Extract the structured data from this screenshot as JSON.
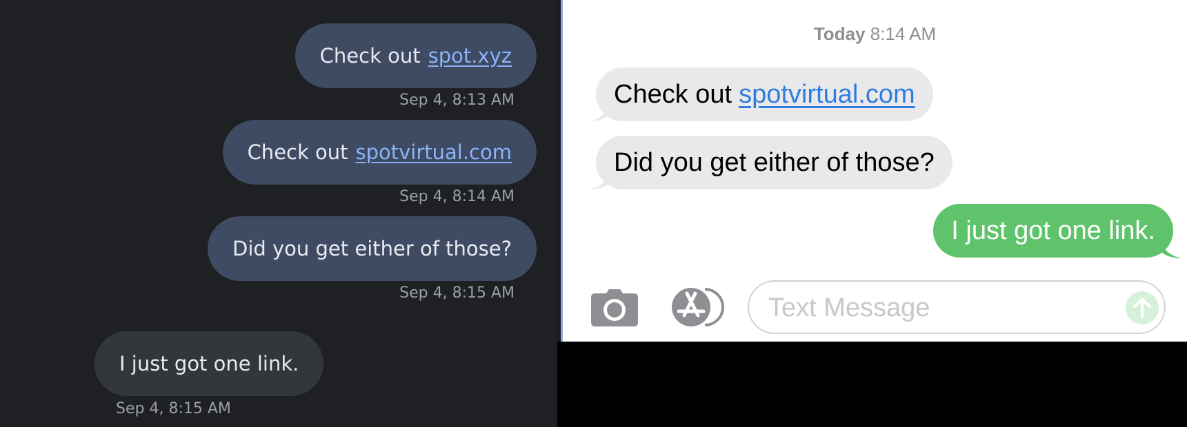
{
  "left_panel": {
    "messages": [
      {
        "prefix": "Check out",
        "link": "spot.xyz",
        "time": "Sep 4, 8:13 AM"
      },
      {
        "prefix": "Check out",
        "link": "spotvirtual.com",
        "time": "Sep 4, 8:14 AM"
      },
      {
        "text": "Did you get either of those?",
        "time": "Sep 4, 8:15 AM"
      },
      {
        "text": "I just got one link.",
        "time": "Sep 4, 8:15 AM"
      }
    ]
  },
  "right_panel": {
    "header": {
      "day": "Today",
      "time": "8:14 AM"
    },
    "messages": [
      {
        "prefix": "Check out",
        "link": "spotvirtual.com"
      },
      {
        "text": "Did you get either of those?"
      },
      {
        "text": "I just got one link."
      }
    ],
    "input": {
      "placeholder": "Text Message"
    },
    "icons": {
      "camera": "camera-icon",
      "apps": "app-store-icon",
      "send": "send-arrow-icon"
    },
    "colors": {
      "incoming": "#e9e9eb",
      "outgoing": "#5ec36a",
      "link": "#2f7de1"
    }
  },
  "colors": {
    "android_outgoing": "#3f4a63",
    "android_incoming": "#33363b",
    "android_link": "#8ab4f8"
  }
}
